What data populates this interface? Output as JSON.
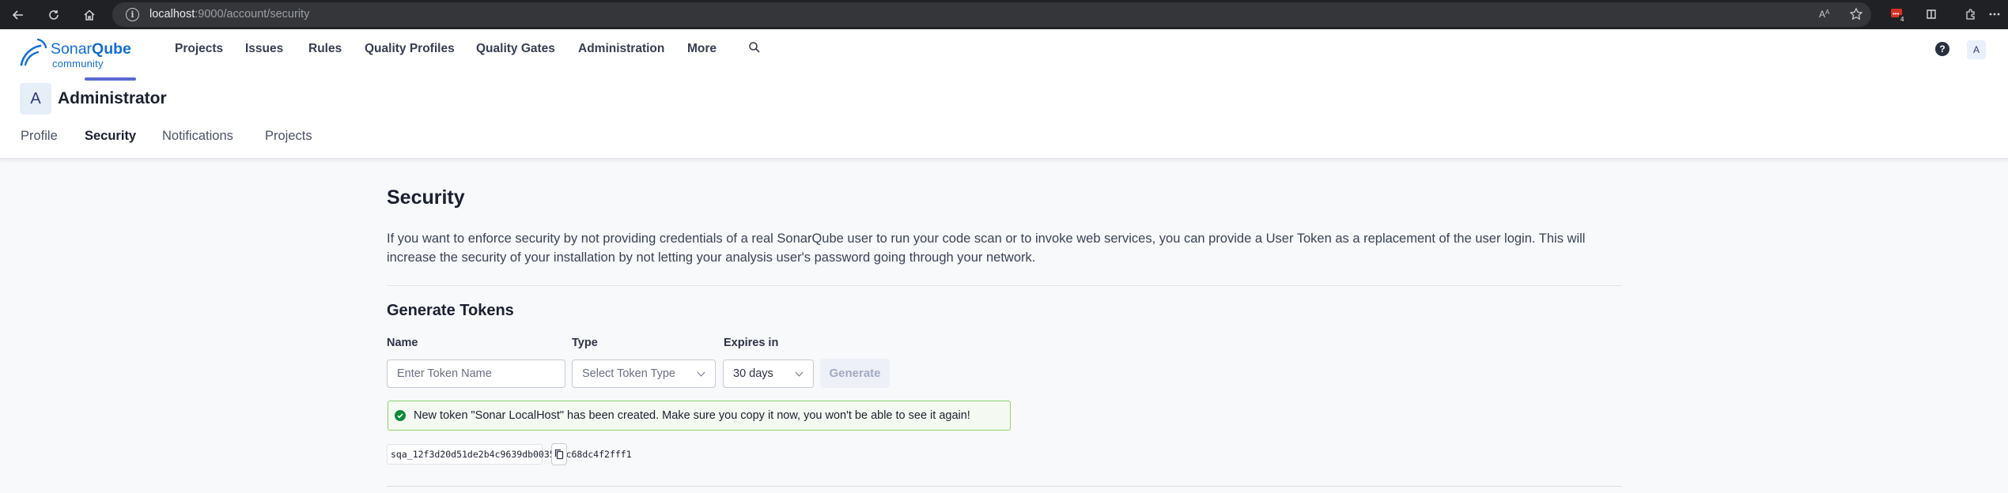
{
  "browser": {
    "url_host": "localhost",
    "url_path": ":9000/account/security",
    "ext_badge": "4",
    "read_aloud": "A"
  },
  "header": {
    "logo_brand_part1": "Sonar",
    "logo_brand_part2": "Qube",
    "logo_edition": "community",
    "nav": [
      "Projects",
      "Issues",
      "Rules",
      "Quality Profiles",
      "Quality Gates",
      "Administration",
      "More"
    ],
    "help_label": "?",
    "user_initial": "A"
  },
  "account": {
    "avatar_initial": "A",
    "name": "Administrator",
    "tabs": [
      "Profile",
      "Security",
      "Notifications",
      "Projects"
    ],
    "active_tab": "Security"
  },
  "security": {
    "title": "Security",
    "description": "If you want to enforce security by not providing credentials of a real SonarQube user to run your code scan or to invoke web services, you can provide a User Token as a replacement of the user login. This will increase the security of your installation by not letting your analysis user's password going through your network.",
    "generate_title": "Generate Tokens",
    "name_label": "Name",
    "name_placeholder": "Enter Token Name",
    "type_label": "Type",
    "type_placeholder": "Select Token Type",
    "expires_label": "Expires in",
    "expires_value": "30 days",
    "generate_button": "Generate",
    "success_message": "New token \"Sonar LocalHost\" has been created. Make sure you copy it now, you won't be able to see it again!",
    "token_value": "sqa_12f3d20d51de2b4c9639db0035d1c68dc4f2fff1"
  },
  "colors": {
    "brand": "#126ed3",
    "tab_active_underline": "#5d6bd4",
    "success": "#0f8a3c"
  }
}
